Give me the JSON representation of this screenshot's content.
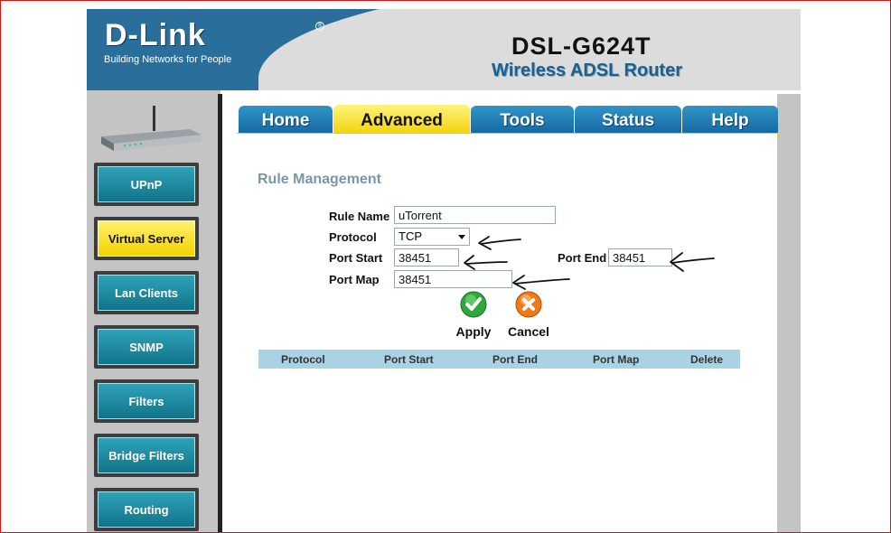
{
  "header": {
    "logo_text": "D-Link",
    "logo_mark": "®",
    "tagline": "Building Networks for People",
    "model": "DSL-G624T",
    "product": "Wireless ADSL Router"
  },
  "tabs": [
    {
      "label": "Home",
      "active": false
    },
    {
      "label": "Advanced",
      "active": true
    },
    {
      "label": "Tools",
      "active": false
    },
    {
      "label": "Status",
      "active": false
    },
    {
      "label": "Help",
      "active": false
    }
  ],
  "sidebar": {
    "items": [
      {
        "label": "UPnP",
        "active": false
      },
      {
        "label": "Virtual Server",
        "active": true
      },
      {
        "label": "Lan Clients",
        "active": false
      },
      {
        "label": "SNMP",
        "active": false
      },
      {
        "label": "Filters",
        "active": false
      },
      {
        "label": "Bridge Filters",
        "active": false
      },
      {
        "label": "Routing",
        "active": false
      }
    ]
  },
  "form": {
    "title": "Rule Management",
    "rule_name_label": "Rule Name",
    "rule_name_value": "uTorrent",
    "protocol_label": "Protocol",
    "protocol_value": "TCP",
    "port_start_label": "Port Start",
    "port_start_value": "38451",
    "port_end_label": "Port End",
    "port_end_value": "38451",
    "port_map_label": "Port Map",
    "port_map_value": "38451",
    "apply_label": "Apply",
    "cancel_label": "Cancel"
  },
  "table": {
    "headers": [
      "Protocol",
      "Port Start",
      "Port End",
      "Port Map",
      "Delete"
    ]
  },
  "colors": {
    "header_blue": "#2a6f9c",
    "tab_blue": "#1f7fb5",
    "active_yellow": "#f3d200",
    "nav_teal": "#1a8aa0",
    "table_header": "#a9d2e4",
    "frame_red": "#e01010"
  }
}
